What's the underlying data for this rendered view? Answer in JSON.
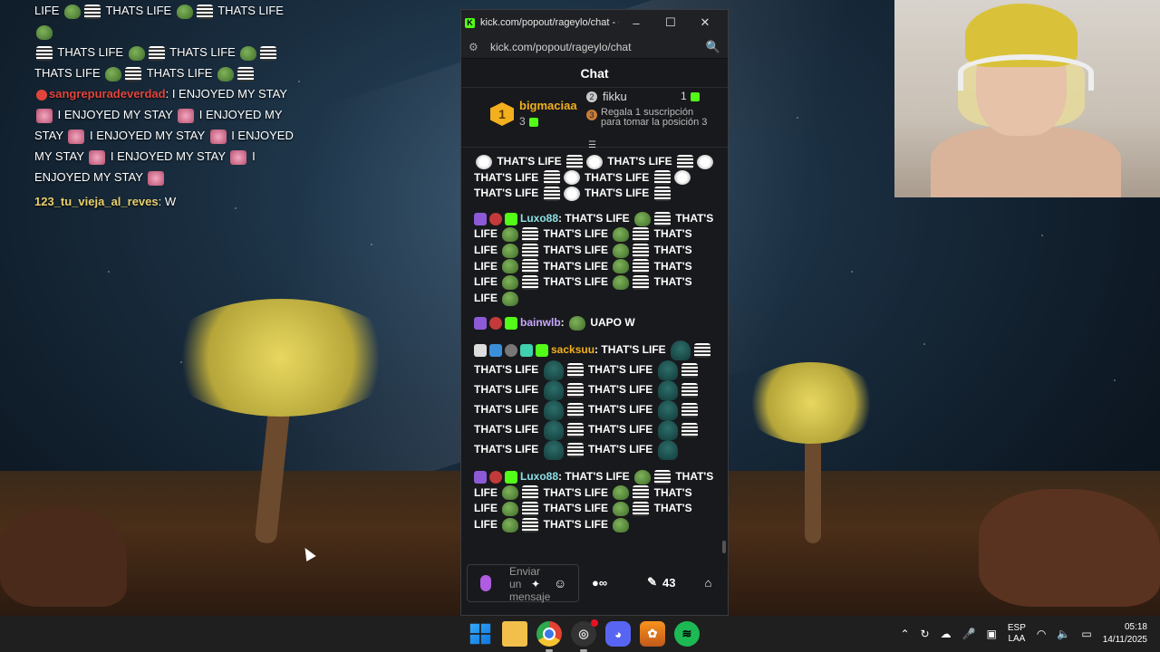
{
  "overlay_chat": {
    "line1": "LIFE",
    "line1b": "THATS LIFE",
    "line1c": "THATS LIFE",
    "line2": "THATS LIFE",
    "line2b": "THATS LIFE",
    "line3": "THATS LIFE",
    "line3b": "THATS LIFE",
    "msg1_user": "sangrepuradeverdad",
    "msg1_a": ": I ENJOYED MY STAY",
    "msg1_b": "I ENJOYED MY STAY",
    "msg1_c": "I ENJOYED MY",
    "msg1_d": "STAY",
    "msg1_e": "I ENJOYED MY STAY",
    "msg1_f": "I ENJOYED",
    "msg1_g": "MY STAY",
    "msg1_h": "I ENJOYED MY STAY",
    "msg1_i": "I",
    "msg1_j": "ENJOYED MY STAY",
    "msg2_user": "123_tu_vieja_al_reves",
    "msg2_text": ": W"
  },
  "window": {
    "title": "kick.com/popout/rageylo/chat - G...",
    "minimize": "–",
    "maximize": "☐",
    "close": "✕",
    "url": "kick.com/popout/rageylo/chat"
  },
  "chat": {
    "header": "Chat",
    "leaderboard": {
      "first_rank": "1",
      "first_name": "bigmaciaa",
      "first_count": "3",
      "second_rank": "2",
      "second_name": "fikku",
      "second_count": "1",
      "third_rank": "3",
      "third_text": "Regala 1 suscripción para tomar la posición 3"
    },
    "messages": [
      {
        "user": "",
        "text": "THAT'S LIFE",
        "repeat": 6,
        "color": "#ffffff"
      },
      {
        "user": "Luxo88",
        "text": "THAT'S LIFE",
        "repeat": 10,
        "color": "#8be0e6"
      },
      {
        "user": "bainwlb",
        "text": "UAPO W",
        "repeat": 1,
        "color": "#c8a8ff"
      },
      {
        "user": "sacksuu",
        "text": "THAT'S LIFE",
        "repeat": 11,
        "color": "#f2b01e"
      },
      {
        "user": "Luxo88",
        "text": "THAT'S LIFE",
        "repeat": 7,
        "color": "#8be0e6"
      }
    ],
    "composer_placeholder": "Enviar un mensaje",
    "points_count": "43"
  },
  "taskbar": {
    "lang_line1": "ESP",
    "lang_line2": "LAA",
    "time": "05:18",
    "date": "14/11/2025"
  }
}
